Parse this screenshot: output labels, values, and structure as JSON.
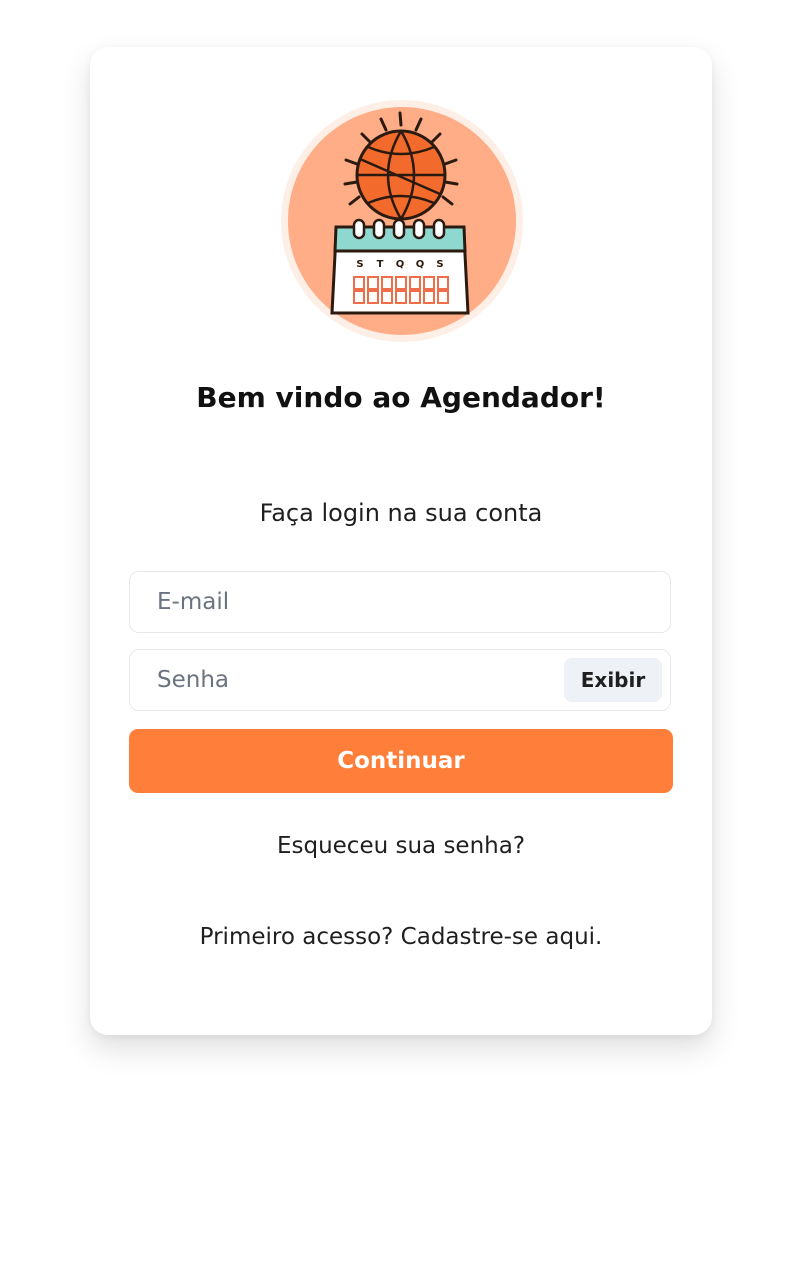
{
  "logo": {
    "icon": "calendar-sun-icon",
    "weekdays": [
      "S",
      "T",
      "Q",
      "Q",
      "S"
    ],
    "colors": {
      "circle": "#ffad86",
      "sun": "#f26b2c",
      "calendar_top": "#8fd8cf",
      "calendar_cells": "#ef6e4a"
    }
  },
  "login": {
    "title": "Bem vindo ao Agendador!",
    "subtitle": "Faça login na sua conta",
    "email_placeholder": "E-mail",
    "password_placeholder": "Senha",
    "show_password_label": "Exibir",
    "continue_label": "Continuar",
    "forgot_password_link": "Esqueceu sua senha?",
    "signup_link": "Primeiro acesso? Cadastre-se aqui."
  },
  "colors": {
    "accent": "#ff7f3a",
    "field_border": "#e6e8ec",
    "show_button_bg": "#eef1f5"
  }
}
